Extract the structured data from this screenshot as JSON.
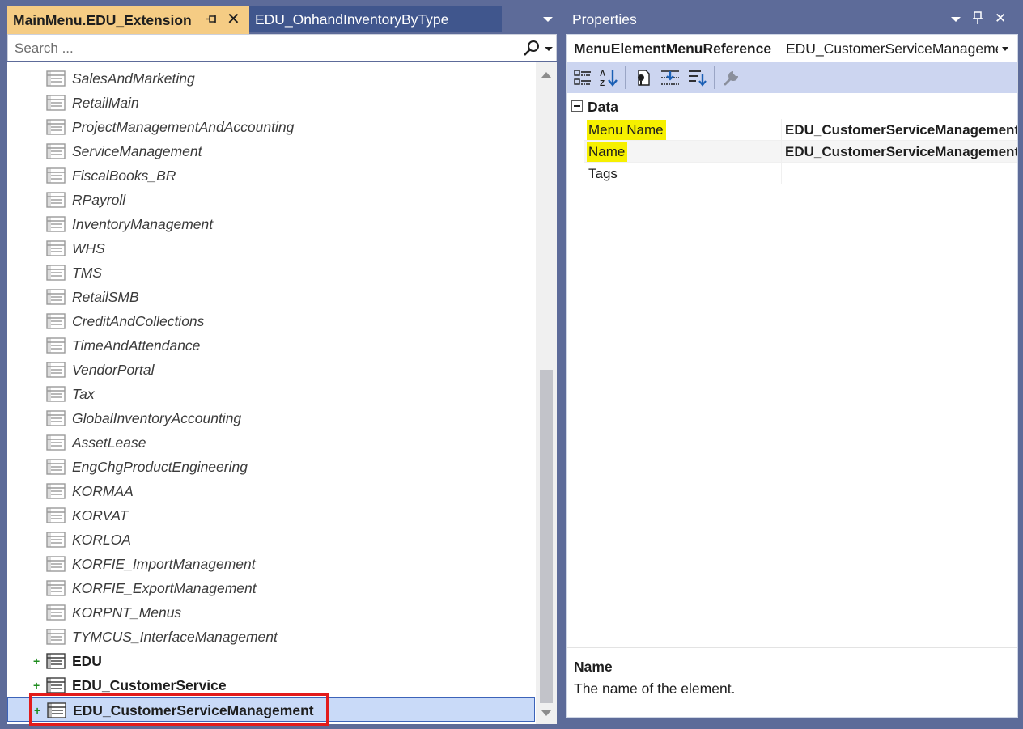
{
  "left_pane": {
    "active_tab": "MainMenu.EDU_Extension",
    "inactive_tab": "EDU_OnhandInventoryByType",
    "search_placeholder": "Search ...",
    "tree_items": [
      {
        "label": "SalesAndMarketing",
        "bold": false,
        "expandable": false
      },
      {
        "label": "RetailMain",
        "bold": false,
        "expandable": false
      },
      {
        "label": "ProjectManagementAndAccounting",
        "bold": false,
        "expandable": false
      },
      {
        "label": "ServiceManagement",
        "bold": false,
        "expandable": false
      },
      {
        "label": "FiscalBooks_BR",
        "bold": false,
        "expandable": false
      },
      {
        "label": "RPayroll",
        "bold": false,
        "expandable": false
      },
      {
        "label": "InventoryManagement",
        "bold": false,
        "expandable": false
      },
      {
        "label": "WHS",
        "bold": false,
        "expandable": false
      },
      {
        "label": "TMS",
        "bold": false,
        "expandable": false
      },
      {
        "label": "RetailSMB",
        "bold": false,
        "expandable": false
      },
      {
        "label": "CreditAndCollections",
        "bold": false,
        "expandable": false
      },
      {
        "label": "TimeAndAttendance",
        "bold": false,
        "expandable": false
      },
      {
        "label": "VendorPortal",
        "bold": false,
        "expandable": false
      },
      {
        "label": "Tax",
        "bold": false,
        "expandable": false
      },
      {
        "label": "GlobalInventoryAccounting",
        "bold": false,
        "expandable": false
      },
      {
        "label": "AssetLease",
        "bold": false,
        "expandable": false
      },
      {
        "label": "EngChgProductEngineering",
        "bold": false,
        "expandable": false
      },
      {
        "label": "KORMAA",
        "bold": false,
        "expandable": false
      },
      {
        "label": "KORVAT",
        "bold": false,
        "expandable": false
      },
      {
        "label": "KORLOA",
        "bold": false,
        "expandable": false
      },
      {
        "label": "KORFIE_ImportManagement",
        "bold": false,
        "expandable": false
      },
      {
        "label": "KORFIE_ExportManagement",
        "bold": false,
        "expandable": false
      },
      {
        "label": "KORPNT_Menus",
        "bold": false,
        "expandable": false
      },
      {
        "label": "TYMCUS_InterfaceManagement",
        "bold": false,
        "expandable": false
      },
      {
        "label": "EDU",
        "bold": true,
        "expandable": true
      },
      {
        "label": "EDU_CustomerService",
        "bold": true,
        "expandable": true
      },
      {
        "label": "EDU_CustomerServiceManagement",
        "bold": true,
        "expandable": true,
        "selected": true
      }
    ]
  },
  "properties": {
    "title": "Properties",
    "object_type": "MenuElementMenuReference",
    "object_name": "EDU_CustomerServiceManagement",
    "category": "Data",
    "rows": [
      {
        "name": "Menu Name",
        "value": "EDU_CustomerServiceManagement",
        "highlighted": true
      },
      {
        "name": "Name",
        "value": "EDU_CustomerServiceManagement",
        "highlighted": true
      },
      {
        "name": "Tags",
        "value": "",
        "highlighted": false
      }
    ],
    "description_title": "Name",
    "description_text": "The name of the element."
  }
}
